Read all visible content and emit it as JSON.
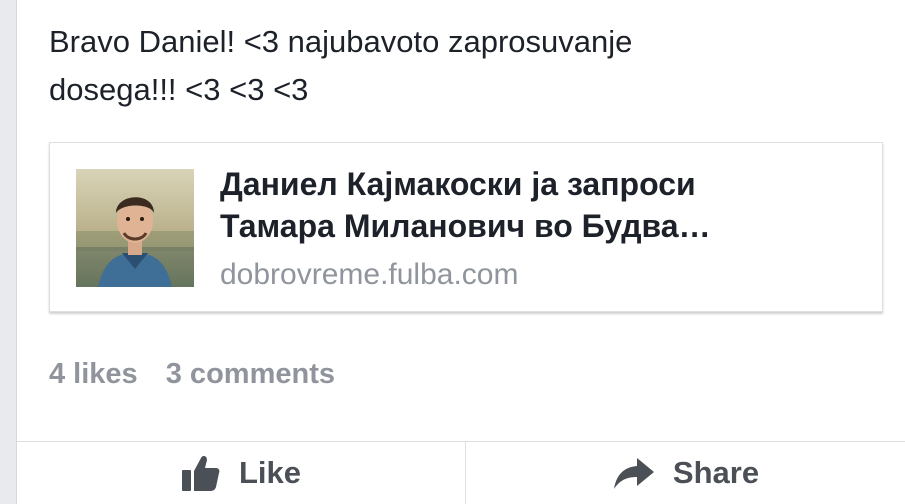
{
  "post": {
    "message_line1": "Bravo Daniel! <3 najubavoto zaprosuvanje",
    "message_line2": "dosega!!! <3 <3 <3"
  },
  "link_preview": {
    "title_line1": "Даниел Кајмакоски ја запроси",
    "title_line2": "Тамара Миланович во Будва…",
    "domain": "dobrovreme.fulba.com",
    "thumbnail_icon": "person-photo"
  },
  "stats": {
    "likes": "4 likes",
    "comments": "3 comments"
  },
  "actions": {
    "like_label": "Like",
    "like_icon": "thumbs-up-icon",
    "share_label": "Share",
    "share_icon": "share-arrow-icon"
  },
  "colors": {
    "text": "#1d2129",
    "muted": "#90949c",
    "action": "#4b4f56"
  }
}
